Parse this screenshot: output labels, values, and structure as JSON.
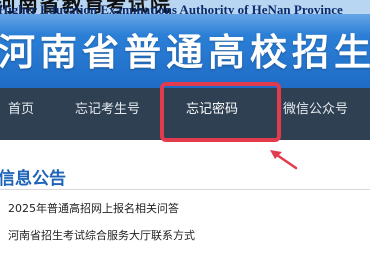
{
  "header": {
    "cn_authority": "河南省教育考试院",
    "en_authority": "Higher Education Examinations Authority of HeNan Province",
    "site_title": "河南省普通高校招生"
  },
  "nav": {
    "items": [
      {
        "label": "首页"
      },
      {
        "label": "忘记考生号"
      },
      {
        "label": "忘记密码"
      },
      {
        "label": "微信公众号"
      }
    ]
  },
  "announcements": {
    "title": "信息公告",
    "items": [
      {
        "text": "2025年普通高招网上报名相关问答"
      },
      {
        "text": "河南省招生考试综合服务大厅联系方式"
      }
    ]
  },
  "colors": {
    "banner_blue": "#1f6cc6",
    "nav_bg": "#2e4052",
    "highlight_red": "#e23b4e",
    "section_title_blue": "#1d63b8"
  }
}
